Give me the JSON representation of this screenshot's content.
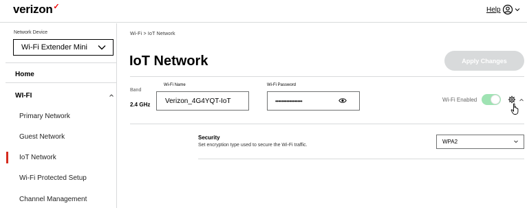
{
  "header": {
    "logo_text": "verizon",
    "logo_check": "✓",
    "help_label": "Help",
    "account_icon": "account-circle-icon"
  },
  "sidebar": {
    "network_device_label": "Network Device",
    "network_device_value": "Wi-Fi Extender Mini",
    "home_label": "Home",
    "wifi_label": "WI-FI",
    "items": [
      {
        "label": "Primary Network",
        "active": false
      },
      {
        "label": "Guest Network",
        "active": false
      },
      {
        "label": "IoT Network",
        "active": true
      },
      {
        "label": "Wi-Fi Protected Setup",
        "active": false
      },
      {
        "label": "Channel Management",
        "active": false
      }
    ]
  },
  "main": {
    "breadcrumb": "Wi-Fi  >  IoT Network",
    "title": "IoT Network",
    "apply_label": "Apply Changes",
    "band_label": "Band",
    "band_value": "2.4 GHz",
    "wifi_name_label": "Wi-Fi Name",
    "wifi_name_value": "Verizon_4G4YQT-IoT",
    "wifi_password_label": "Wi-Fi Password",
    "wifi_password_value": "•••••••••••••••••",
    "wifi_enabled_label": "Wi-Fi Enabled",
    "wifi_enabled": true,
    "security": {
      "title": "Security",
      "description": "Set encryption type used to secure the Wi-Fi traffic.",
      "value": "WPA2"
    }
  },
  "colors": {
    "brand_red": "#d52b1e",
    "toggle_on": "#9fe3b3",
    "disabled_button": "#d8dadb"
  }
}
